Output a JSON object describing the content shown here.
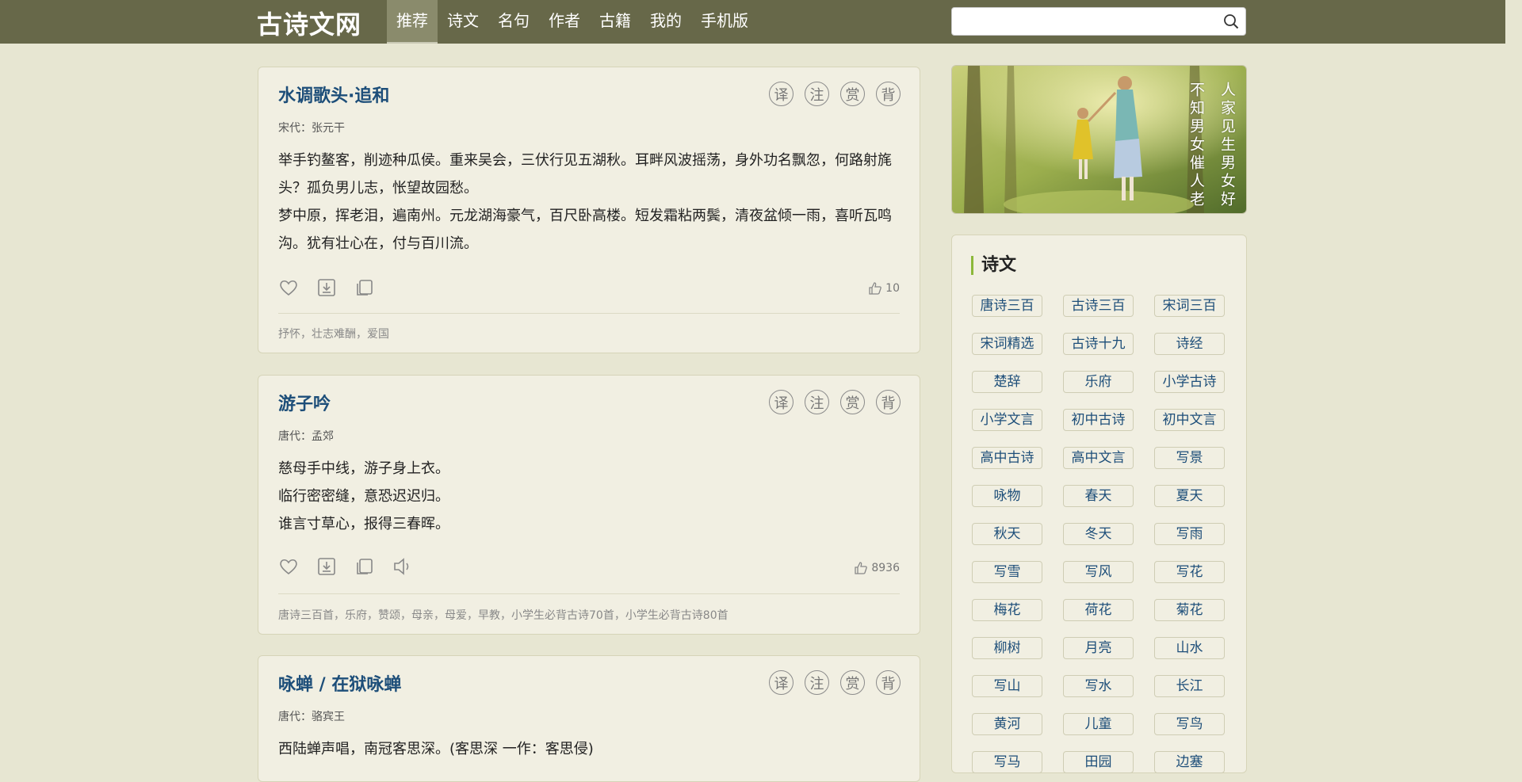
{
  "header": {
    "logo": "古诗文网",
    "nav": [
      "推荐",
      "诗文",
      "名句",
      "作者",
      "古籍",
      "我的",
      "手机版"
    ],
    "search_placeholder": ""
  },
  "poems": [
    {
      "title": "水调歌头·追和",
      "dynasty": "宋代：",
      "author": "张元干",
      "lines": [
        "举手钓鳌客，削迹种瓜侯。重来吴会，三伏行见五湖秋。耳畔风波摇荡，身外功名飘忽，何路射旄头？孤负男儿志，怅望故园愁。",
        "梦中原，挥老泪，遍南州。元龙湖海豪气，百尺卧高楼。短发霜粘两鬓，清夜盆倾一雨，喜听瓦鸣沟。犹有壮心在，付与百川流。"
      ],
      "likes": "10",
      "tags": "抒怀，壮志难酬，爱国"
    },
    {
      "title": "游子吟",
      "dynasty": "唐代：",
      "author": "孟郊",
      "lines": [
        "慈母手中线，游子身上衣。",
        "临行密密缝，意恐迟迟归。",
        "谁言寸草心，报得三春晖。"
      ],
      "likes": "8936",
      "tags": "唐诗三百首，乐府，赞颂，母亲，母爱，早教，小学生必背古诗70首，小学生必背古诗80首"
    },
    {
      "title": "咏蝉 / 在狱咏蝉",
      "dynasty": "唐代：",
      "author": "骆宾王",
      "lines": [
        "西陆蝉声唱，南冠客思深。(客思深 一作：客思侵)"
      ]
    }
  ],
  "tools": [
    "译",
    "注",
    "赏",
    "背"
  ],
  "banner": {
    "col1": "人家见生男女好",
    "col2": "不知男女催人老"
  },
  "sidebar": {
    "title": "诗文",
    "chips": [
      "唐诗三百",
      "古诗三百",
      "宋词三百",
      "宋词精选",
      "古诗十九",
      "诗经",
      "楚辞",
      "乐府",
      "小学古诗",
      "小学文言",
      "初中古诗",
      "初中文言",
      "高中古诗",
      "高中文言",
      "写景",
      "咏物",
      "春天",
      "夏天",
      "秋天",
      "冬天",
      "写雨",
      "写雪",
      "写风",
      "写花",
      "梅花",
      "荷花",
      "菊花",
      "柳树",
      "月亮",
      "山水",
      "写山",
      "写水",
      "长江",
      "黄河",
      "儿童",
      "写鸟",
      "写马",
      "田园",
      "边塞"
    ]
  }
}
